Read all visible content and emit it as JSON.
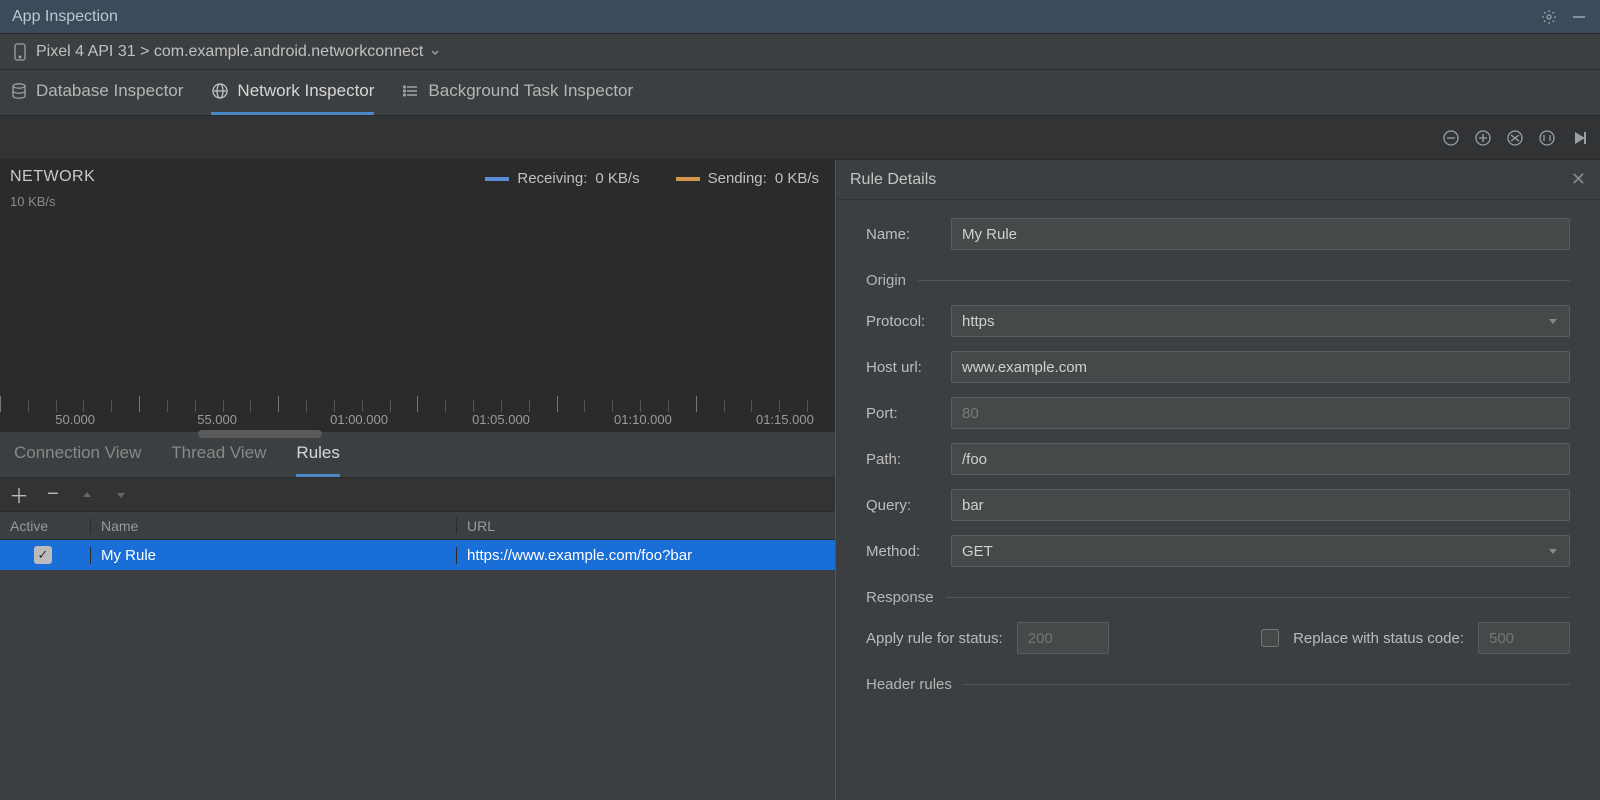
{
  "title_bar": {
    "title": "App Inspection"
  },
  "breadcrumb": {
    "text": "Pixel 4 API 31 > com.example.android.networkconnect"
  },
  "top_tabs": {
    "database": "Database Inspector",
    "network": "Network Inspector",
    "background": "Background Task Inspector"
  },
  "chart": {
    "title": "NETWORK",
    "y_label": "10 KB/s",
    "legend": {
      "receiving": {
        "label": "Receiving:",
        "value": "0 KB/s",
        "color": "#5b8dd6"
      },
      "sending": {
        "label": "Sending:",
        "value": "0 KB/s",
        "color": "#d6954e"
      }
    },
    "ticks": [
      "50.000",
      "55.000",
      "01:00.000",
      "01:05.000",
      "01:10.000",
      "01:15.000"
    ]
  },
  "sub_tabs": {
    "connection": "Connection View",
    "thread": "Thread View",
    "rules": "Rules"
  },
  "rules_table": {
    "headers": {
      "active": "Active",
      "name": "Name",
      "url": "URL"
    },
    "row": {
      "active": true,
      "name": "My Rule",
      "url": "https://www.example.com/foo?bar"
    }
  },
  "details": {
    "header": "Rule Details",
    "name_label": "Name:",
    "name_value": "My Rule",
    "section_origin": "Origin",
    "protocol_label": "Protocol:",
    "protocol_value": "https",
    "host_label": "Host url:",
    "host_value": "www.example.com",
    "port_label": "Port:",
    "port_placeholder": "80",
    "path_label": "Path:",
    "path_value": "/foo",
    "query_label": "Query:",
    "query_value": "bar",
    "method_label": "Method:",
    "method_value": "GET",
    "section_response": "Response",
    "apply_status_label": "Apply rule for status:",
    "apply_status_placeholder": "200",
    "replace_label": "Replace with status code:",
    "replace_placeholder": "500",
    "section_header_rules": "Header rules"
  }
}
